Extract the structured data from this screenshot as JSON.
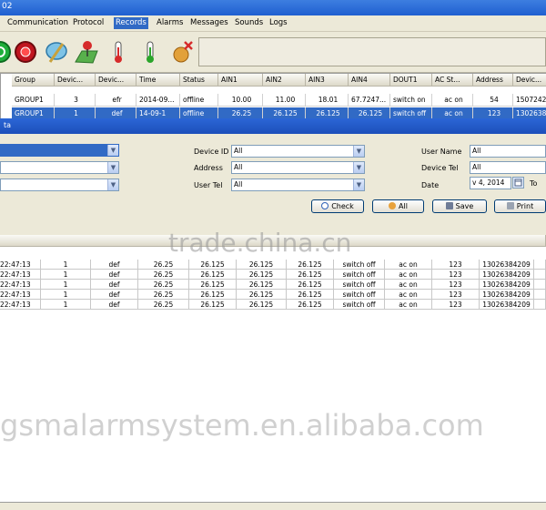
{
  "window": {
    "title_fragment": "02"
  },
  "menu": [
    "Communication",
    "Protocol",
    "Records",
    "Alarms",
    "Messages",
    "Sounds",
    "Logs"
  ],
  "menu_active": "Records",
  "toolbar_icons": [
    "green-power-icon",
    "red-stop-icon",
    "satellite-dish-icon",
    "map-pin-icon",
    "thermometer-icon",
    "humidity-meter-icon",
    "alarm-cancel-icon"
  ],
  "top_grid": {
    "headers": [
      "Group",
      "Devic...",
      "Devic...",
      "Time",
      "Status",
      "AIN1",
      "AIN2",
      "AIN3",
      "AIN4",
      "DOUT1",
      "AC St...",
      "Address",
      "Devic..."
    ],
    "rows": [
      [
        "GROUP1",
        "3",
        "efr",
        "2014-09...",
        "offline",
        "10.00",
        "11.00",
        "18.01",
        "67.7247...",
        "switch on",
        "ac on",
        "54",
        "1507242..."
      ],
      [
        "GROUP1",
        "1",
        "def",
        "14-09-1",
        "offline",
        "26.25",
        "26.125",
        "26.125",
        "26.125",
        "switch off",
        "ac on",
        "123",
        "1302638..."
      ]
    ]
  },
  "dialog": {
    "title_fragment": "ta"
  },
  "filters": {
    "device_id_label": "Device ID",
    "device_id_value": "All",
    "address_label": "Address",
    "address_value": "All",
    "user_tel_label": "User Tel",
    "user_tel_value": "All",
    "user_name_label": "User Name",
    "user_name_value": "All",
    "device_tel_label": "Device Tel",
    "device_tel_value": "All",
    "date_label": "Date",
    "date_value": "v 4, 2014",
    "to_label": "To"
  },
  "buttons": {
    "check": "Check",
    "all": "All",
    "save": "Save",
    "print": "Print"
  },
  "results": {
    "rows": [
      [
        "22:47:13",
        "1",
        "def",
        "26.25",
        "26.125",
        "26.125",
        "26.125",
        "switch off",
        "ac on",
        "123",
        "13026384209"
      ],
      [
        "22:47:13",
        "1",
        "def",
        "26.25",
        "26.125",
        "26.125",
        "26.125",
        "switch off",
        "ac on",
        "123",
        "13026384209"
      ],
      [
        "22:47:13",
        "1",
        "def",
        "26.25",
        "26.125",
        "26.125",
        "26.125",
        "switch off",
        "ac on",
        "123",
        "13026384209"
      ],
      [
        "22:47:13",
        "1",
        "def",
        "26.25",
        "26.125",
        "26.125",
        "26.125",
        "switch off",
        "ac on",
        "123",
        "13026384209"
      ],
      [
        "22:47:13",
        "1",
        "def",
        "26.25",
        "26.125",
        "26.125",
        "26.125",
        "switch off",
        "ac on",
        "123",
        "13026384209"
      ]
    ]
  },
  "watermarks": {
    "top": "trade.china.cn",
    "bottom": "gsmalarmsystem.en.alibaba.com"
  },
  "colors": {
    "selection": "#316ac5",
    "title_bar": "#1f5fd0"
  }
}
